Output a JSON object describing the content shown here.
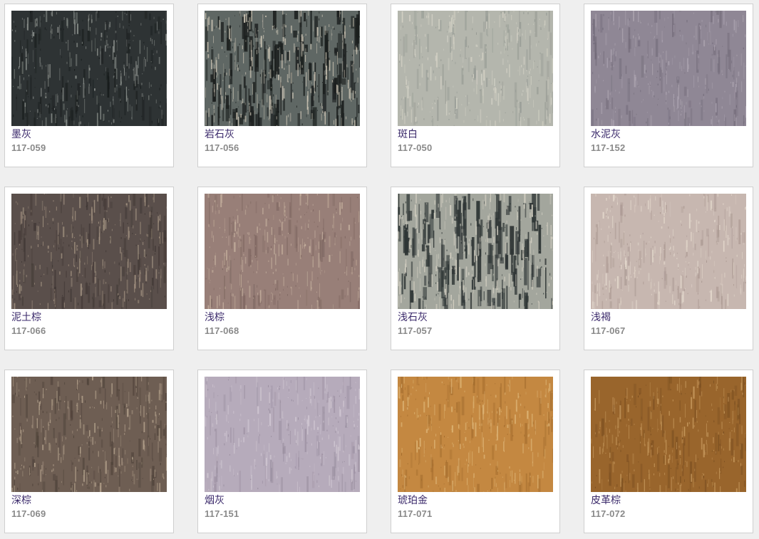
{
  "swatches": [
    {
      "name": "墨灰",
      "code": "117-059",
      "base": "#2e3334",
      "light": "#8c918d",
      "dark": "#151919",
      "streak": 0.45,
      "mottle": "dark"
    },
    {
      "name": "岩石灰",
      "code": "117-056",
      "base": "#5f6764",
      "light": "#c9c2b2",
      "dark": "#1b1f1e",
      "streak": 0.55,
      "mottle": "contrast"
    },
    {
      "name": "斑白",
      "code": "117-050",
      "base": "#b4b6ad",
      "light": "#d4d2c6",
      "dark": "#8e938d",
      "streak": 0.3,
      "mottle": "soft"
    },
    {
      "name": "水泥灰",
      "code": "117-152",
      "base": "#8f8795",
      "light": "#aaa2ae",
      "dark": "#6f6876",
      "streak": 0.25,
      "mottle": "soft"
    },
    {
      "name": "泥土棕",
      "code": "117-066",
      "base": "#5a4f4b",
      "light": "#a49482",
      "dark": "#3a322f",
      "streak": 0.35,
      "mottle": "dark"
    },
    {
      "name": "浅棕",
      "code": "117-068",
      "base": "#987f78",
      "light": "#c5b09e",
      "dark": "#7a635d",
      "streak": 0.3,
      "mottle": "soft"
    },
    {
      "name": "浅石灰",
      "code": "117-057",
      "base": "#a3a69d",
      "light": "#d3cfc2",
      "dark": "#2e3535",
      "streak": 0.4,
      "mottle": "contrast"
    },
    {
      "name": "浅褐",
      "code": "117-067",
      "base": "#c7b7b0",
      "light": "#e3d8cc",
      "dark": "#a6948d",
      "streak": 0.3,
      "mottle": "soft"
    },
    {
      "name": "深棕",
      "code": "117-069",
      "base": "#6e5e53",
      "light": "#b6a48e",
      "dark": "#4b3f37",
      "streak": 0.35,
      "mottle": "dark"
    },
    {
      "name": "烟灰",
      "code": "117-151",
      "base": "#b6abbb",
      "light": "#cfc6d1",
      "dark": "#958a9b",
      "streak": 0.25,
      "mottle": "soft"
    },
    {
      "name": "琥珀金",
      "code": "117-071",
      "base": "#c48841",
      "light": "#ddb475",
      "dark": "#a06a2c",
      "streak": 0.3,
      "mottle": "soft"
    },
    {
      "name": "皮革棕",
      "code": "117-072",
      "base": "#99652c",
      "light": "#c79a5e",
      "dark": "#754b1f",
      "streak": 0.3,
      "mottle": "soft"
    }
  ]
}
